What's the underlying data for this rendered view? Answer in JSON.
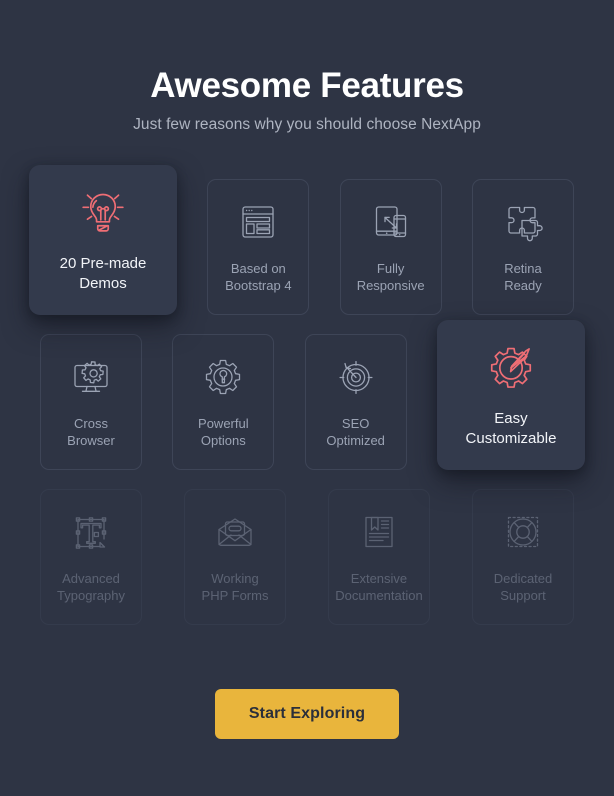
{
  "header": {
    "title": "Awesome Features",
    "subtitle": "Just few reasons why you should choose NextApp"
  },
  "colors": {
    "background": "#2e3444",
    "card_border": "#3e4557",
    "card_active_bg": "#333a4c",
    "icon_default": "#9ba3b4",
    "icon_active": "#ef6e75",
    "text_default": "#9ba3b4",
    "text_active": "#f2f4f8",
    "title": "#ffffff",
    "subtitle": "#aeb4c1",
    "cta_background": "#e9b53c",
    "cta_text": "#2b2f3a"
  },
  "features": {
    "rows": [
      {
        "faded": false,
        "cards": [
          {
            "label": "20 Pre-made\nDemos",
            "icon": "lightbulb-icon",
            "active": true
          },
          {
            "label": "Based on\nBootstrap 4",
            "icon": "layout-window-icon",
            "active": false
          },
          {
            "label": "Fully\nResponsive",
            "icon": "tablet-phone-icon",
            "active": false
          },
          {
            "label": "Retina\nReady",
            "icon": "puzzle-pieces-icon",
            "active": false
          }
        ]
      },
      {
        "faded": false,
        "cards": [
          {
            "label": "Cross\nBrowser",
            "icon": "monitor-gear-icon",
            "active": false
          },
          {
            "label": "Powerful\nOptions",
            "icon": "gear-wrench-icon",
            "active": false
          },
          {
            "label": "SEO\nOptimized",
            "icon": "target-arrow-icon",
            "active": false
          },
          {
            "label": "Easy\nCustomizable",
            "icon": "gear-pencil-icon",
            "active": true
          }
        ]
      },
      {
        "faded": true,
        "cards": [
          {
            "label": "Advanced\nTypography",
            "icon": "text-transform-icon",
            "active": false
          },
          {
            "label": "Working\nPHP Forms",
            "icon": "envelope-open-icon",
            "active": false
          },
          {
            "label": "Extensive\nDocumentation",
            "icon": "book-bookmark-icon",
            "active": false
          },
          {
            "label": "Dedicated\nSupport",
            "icon": "life-ring-icon",
            "active": false
          }
        ]
      }
    ]
  },
  "cta": {
    "label": "Start Exploring"
  }
}
